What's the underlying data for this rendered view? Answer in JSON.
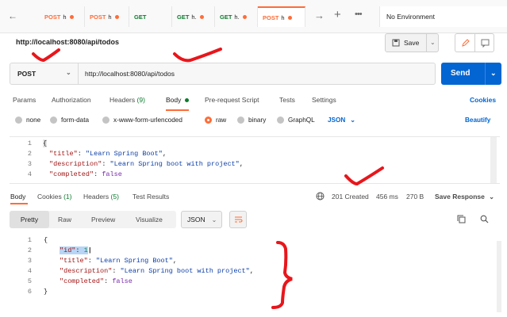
{
  "tabs": [
    {
      "method": "POST",
      "name": "h",
      "method_color": "#ff6c37"
    },
    {
      "method": "POST",
      "name": "h",
      "method_color": "#ff6c37"
    },
    {
      "method": "GET",
      "name": "",
      "method_color": "#0c7a2e"
    },
    {
      "method": "GET",
      "name": "h.",
      "method_color": "#0c7a2e"
    },
    {
      "method": "GET",
      "name": "h.",
      "method_color": "#0c7a2e"
    },
    {
      "method": "POST",
      "name": "h",
      "method_color": "#ff6c37"
    }
  ],
  "environment": "No Environment",
  "request_name": "http://localhost:8080/api/todos",
  "save_label": "Save",
  "method": "POST",
  "url": "http://localhost:8080/api/todos",
  "send_label": "Send",
  "request_tabs": {
    "params": "Params",
    "authorization": "Authorization",
    "headers": "Headers",
    "headers_count": "(9)",
    "body": "Body",
    "prerequest": "Pre-request Script",
    "tests": "Tests",
    "settings": "Settings",
    "cookies": "Cookies"
  },
  "body_types": {
    "none": "none",
    "form_data": "form-data",
    "urlencoded": "x-www-form-urlencoded",
    "raw": "raw",
    "binary": "binary",
    "graphql": "GraphQL",
    "json": "JSON",
    "beautify": "Beautify"
  },
  "request_body_lines": [
    {
      "n": "1",
      "text": "{"
    },
    {
      "n": "2",
      "key": "\"title\"",
      "val": "\"Learn Spring Boot\"",
      "end": ","
    },
    {
      "n": "3",
      "key": "\"description\"",
      "val": "\"Learn Spring boot with project\"",
      "end": ","
    },
    {
      "n": "4",
      "key": "\"completed\"",
      "val": "false",
      "end": ""
    }
  ],
  "response_tabs": {
    "body": "Body",
    "cookies": "Cookies",
    "cookies_count": "(1)",
    "headers": "Headers",
    "headers_count": "(5)",
    "test_results": "Test Results"
  },
  "response_status": {
    "status": "201 Created",
    "time": "456 ms",
    "size": "270 B",
    "save_response": "Save Response"
  },
  "response_views": {
    "pretty": "Pretty",
    "raw": "Raw",
    "preview": "Preview",
    "visualize": "Visualize",
    "format": "JSON"
  },
  "response_body_lines": [
    {
      "n": "1",
      "text": "{"
    },
    {
      "n": "2",
      "key": "\"id\"",
      "val": "1",
      "end": ""
    },
    {
      "n": "3",
      "key": "\"title\"",
      "val": "\"Learn Spring Boot\"",
      "end": ","
    },
    {
      "n": "4",
      "key": "\"description\"",
      "val": "\"Learn Spring boot with project\"",
      "end": ","
    },
    {
      "n": "5",
      "key": "\"completed\"",
      "val": "false",
      "end": ""
    },
    {
      "n": "6",
      "text": "}"
    }
  ],
  "colors": {
    "accent": "#ff6c37",
    "primary": "#0265d2",
    "success": "#0c7a2e",
    "annotation": "#e8161b"
  }
}
